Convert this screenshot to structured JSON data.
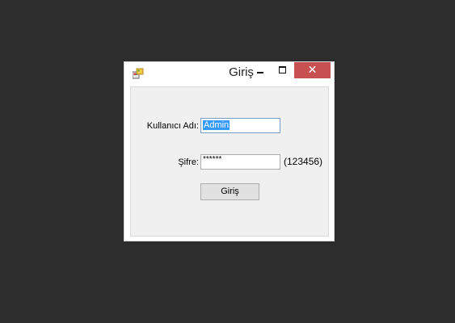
{
  "window": {
    "title": "Giriş",
    "close_glyph": "✕"
  },
  "form": {
    "username_label": "Kullanıcı Adı:",
    "username_value": "Admin",
    "password_label": "Şifre:",
    "password_mask": "******",
    "password_hint": "(123456)",
    "login_button": "Giriş"
  },
  "colors": {
    "desktop_bg": "#2d2d2d",
    "close_button": "#c75050",
    "selection": "#3399ff",
    "form_bg": "#f0f0f0"
  },
  "icons": {
    "app": "app-icon",
    "minimize": "minimize-icon",
    "maximize": "maximize-icon",
    "close": "close-icon"
  }
}
